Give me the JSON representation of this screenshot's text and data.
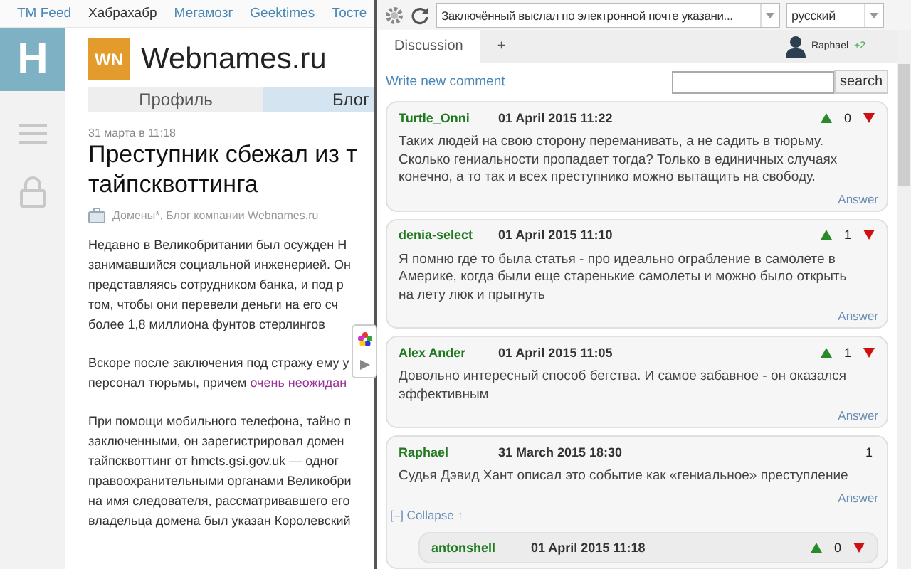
{
  "site_nav": [
    {
      "label": "TM Feed",
      "selected": false
    },
    {
      "label": "Хабрахабр",
      "selected": true
    },
    {
      "label": "Мегамозг",
      "selected": false
    },
    {
      "label": "Geektimes",
      "selected": false
    },
    {
      "label": "Тосте",
      "selected": false
    }
  ],
  "logo": {
    "letter": "H"
  },
  "company": {
    "badge": "WN",
    "name": "Webnames.ru"
  },
  "profile_tabs": [
    {
      "label": "Профиль",
      "selected": false
    },
    {
      "label": "Блог",
      "selected": true
    }
  ],
  "article": {
    "date": "31 марта в 11:18",
    "title": [
      "Преступник сбежал из т",
      "тайпсквоттинга"
    ],
    "hubs": "Домены*, Блог компании Webnames.ru",
    "paragraphs": [
      [
        "Недавно в Великобритании был осужден Н",
        "занимавшийся социальной инженерией. Он",
        "представляясь сотрудником банка, и под р",
        "том, чтобы они перевели деньги на его сч",
        "более 1,8 миллиона фунтов стерлингов"
      ],
      [
        "Вскоре после заключения под стражу ему у",
        {
          "text": "персонал тюрьмы, причем",
          "link": "очень неожидан"
        }
      ],
      [
        "При помощи мобильного телефона, тайно п",
        "заключенными, он зарегистрировал домен",
        "тайпсквоттинг от hmcts.gsi.gov.uk — одног",
        "правоохранительными органами Великобри",
        "на имя следователя, рассматривавшего его",
        "владельца домена был указан Королевский"
      ]
    ]
  },
  "panel": {
    "page_select": "Заключённый выслал по электронной почте указани...",
    "language_select": "русский",
    "tabs": [
      {
        "label": "Discussion",
        "selected": true
      },
      {
        "label": "+",
        "selected": false
      }
    ],
    "user": {
      "name": "Raphael",
      "badge": "+2"
    },
    "write_link": "Write new comment",
    "search": {
      "button": "search"
    },
    "comments": [
      {
        "author": "Turtle_Onni",
        "date": "01 April 2015 11:22",
        "voting": true,
        "score": "0",
        "text": "Таких людей на свою сторону переманивать, а не садить в тюрьму. Сколько гениальности пропадает тогда? Только в единичных случаях конечно, а то так и всех преступнико можно вытащить на свободу.",
        "answer": "Answer"
      },
      {
        "author": "denia-select",
        "date": "01 April 2015 11:10",
        "voting": true,
        "score": "1",
        "text": "Я помню где то была статья - про идеально ограбление в самолете в Америке, когда были еще старенькие самолеты и можно было открыть на лету люк и прыгнуть",
        "answer": "Answer"
      },
      {
        "author": "Alex Ander",
        "date": "01 April 2015 11:05",
        "voting": true,
        "score": "1",
        "text": "Довольно интересный способ бегства. И самое забавное - он оказался эффективным",
        "answer": "Answer"
      },
      {
        "author": "Raphael",
        "date": "31 March 2015 18:30",
        "voting": false,
        "score": "1",
        "text": "Судья Дэвид Хант описал это событие как «гениальное» преступление",
        "answer": "Answer",
        "collapse": "[–] Collapse ↑",
        "children": [
          {
            "author": "antonshell",
            "date": "01 April 2015 11:18",
            "voting": true,
            "score": "0"
          }
        ]
      }
    ]
  }
}
